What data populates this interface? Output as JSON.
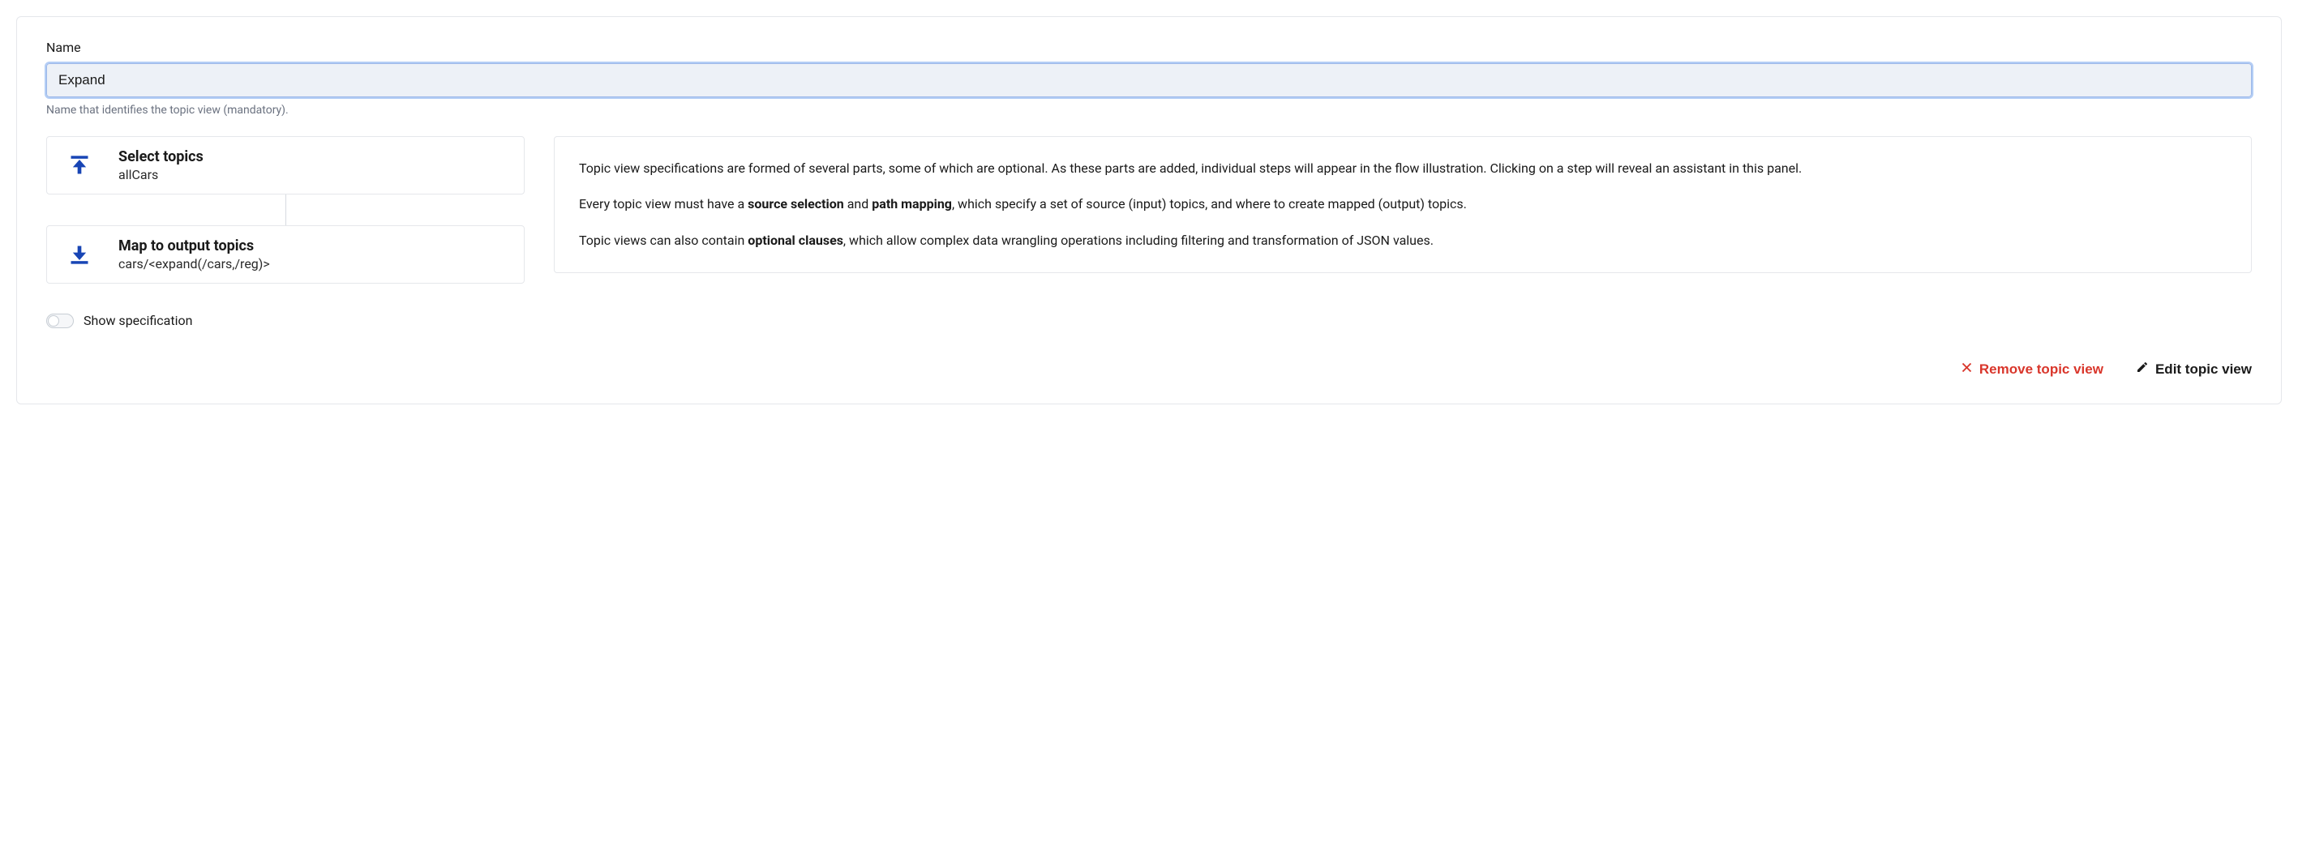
{
  "form": {
    "name_label": "Name",
    "name_value": "Expand",
    "name_help": "Name that identifies the topic view (mandatory)."
  },
  "flow": {
    "select": {
      "title": "Select topics",
      "subtitle": "allCars"
    },
    "map": {
      "title": "Map to output topics",
      "subtitle": "cars/<expand(/cars,/reg)>"
    }
  },
  "info": {
    "p1": "Topic view specifications are formed of several parts, some of which are optional. As these parts are added, individual steps will appear in the flow illustration. Clicking on a step will reveal an assistant in this panel.",
    "p2_a": "Every topic view must have a ",
    "p2_b1": "source selection",
    "p2_c": " and ",
    "p2_b2": "path mapping",
    "p2_d": ", which specify a set of source (input) topics, and where to create mapped (output) topics.",
    "p3_a": "Topic views can also contain ",
    "p3_b": "optional clauses",
    "p3_c": ", which allow complex data wrangling operations including filtering and transformation of JSON values."
  },
  "toggle": {
    "label": "Show specification"
  },
  "actions": {
    "remove": "Remove topic view",
    "edit": "Edit topic view"
  }
}
